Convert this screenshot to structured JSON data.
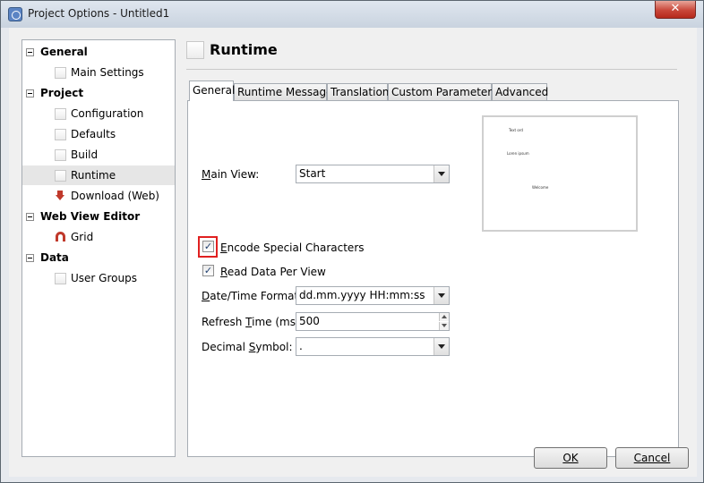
{
  "window": {
    "title": "Project Options - Untitled1",
    "close_glyph": "✕"
  },
  "tree": {
    "groups": [
      {
        "label": "General",
        "items": [
          "Main Settings"
        ]
      },
      {
        "label": "Project",
        "items": [
          "Configuration",
          "Defaults",
          "Build",
          "Runtime",
          "Download (Web)"
        ]
      },
      {
        "label": "Web View Editor",
        "items": [
          "Grid"
        ]
      },
      {
        "label": "Data",
        "items": [
          "User Groups"
        ]
      }
    ],
    "selected": "Runtime"
  },
  "page": {
    "title": "Runtime"
  },
  "tabs": [
    "General",
    "Runtime Message",
    "Translation",
    "Custom Parameters",
    "Advanced"
  ],
  "active_tab": "General",
  "form": {
    "main_view": {
      "label": "Main View:",
      "value": "Start"
    },
    "encode_special": {
      "label": "Encode Special Characters",
      "checked": true
    },
    "read_data_per_view": {
      "label": "Read Data Per View",
      "checked": true
    },
    "datetime_format": {
      "label": "Date/Time Format:",
      "value": "dd.mm.yyyy HH:mm:ss"
    },
    "refresh_time": {
      "label": "Refresh Time (ms):",
      "value": "500"
    },
    "decimal_symbol": {
      "label": "Decimal Symbol:",
      "value": "."
    }
  },
  "preview": {
    "texts": [
      "Text ord",
      "Loren ipsum",
      "Welcome"
    ]
  },
  "buttons": {
    "ok": "OK",
    "cancel": "Cancel"
  },
  "check_glyph": "✓",
  "colors": {
    "highlight": "#e02020",
    "title_bar": "#c9d3df",
    "close": "#c9473a"
  }
}
